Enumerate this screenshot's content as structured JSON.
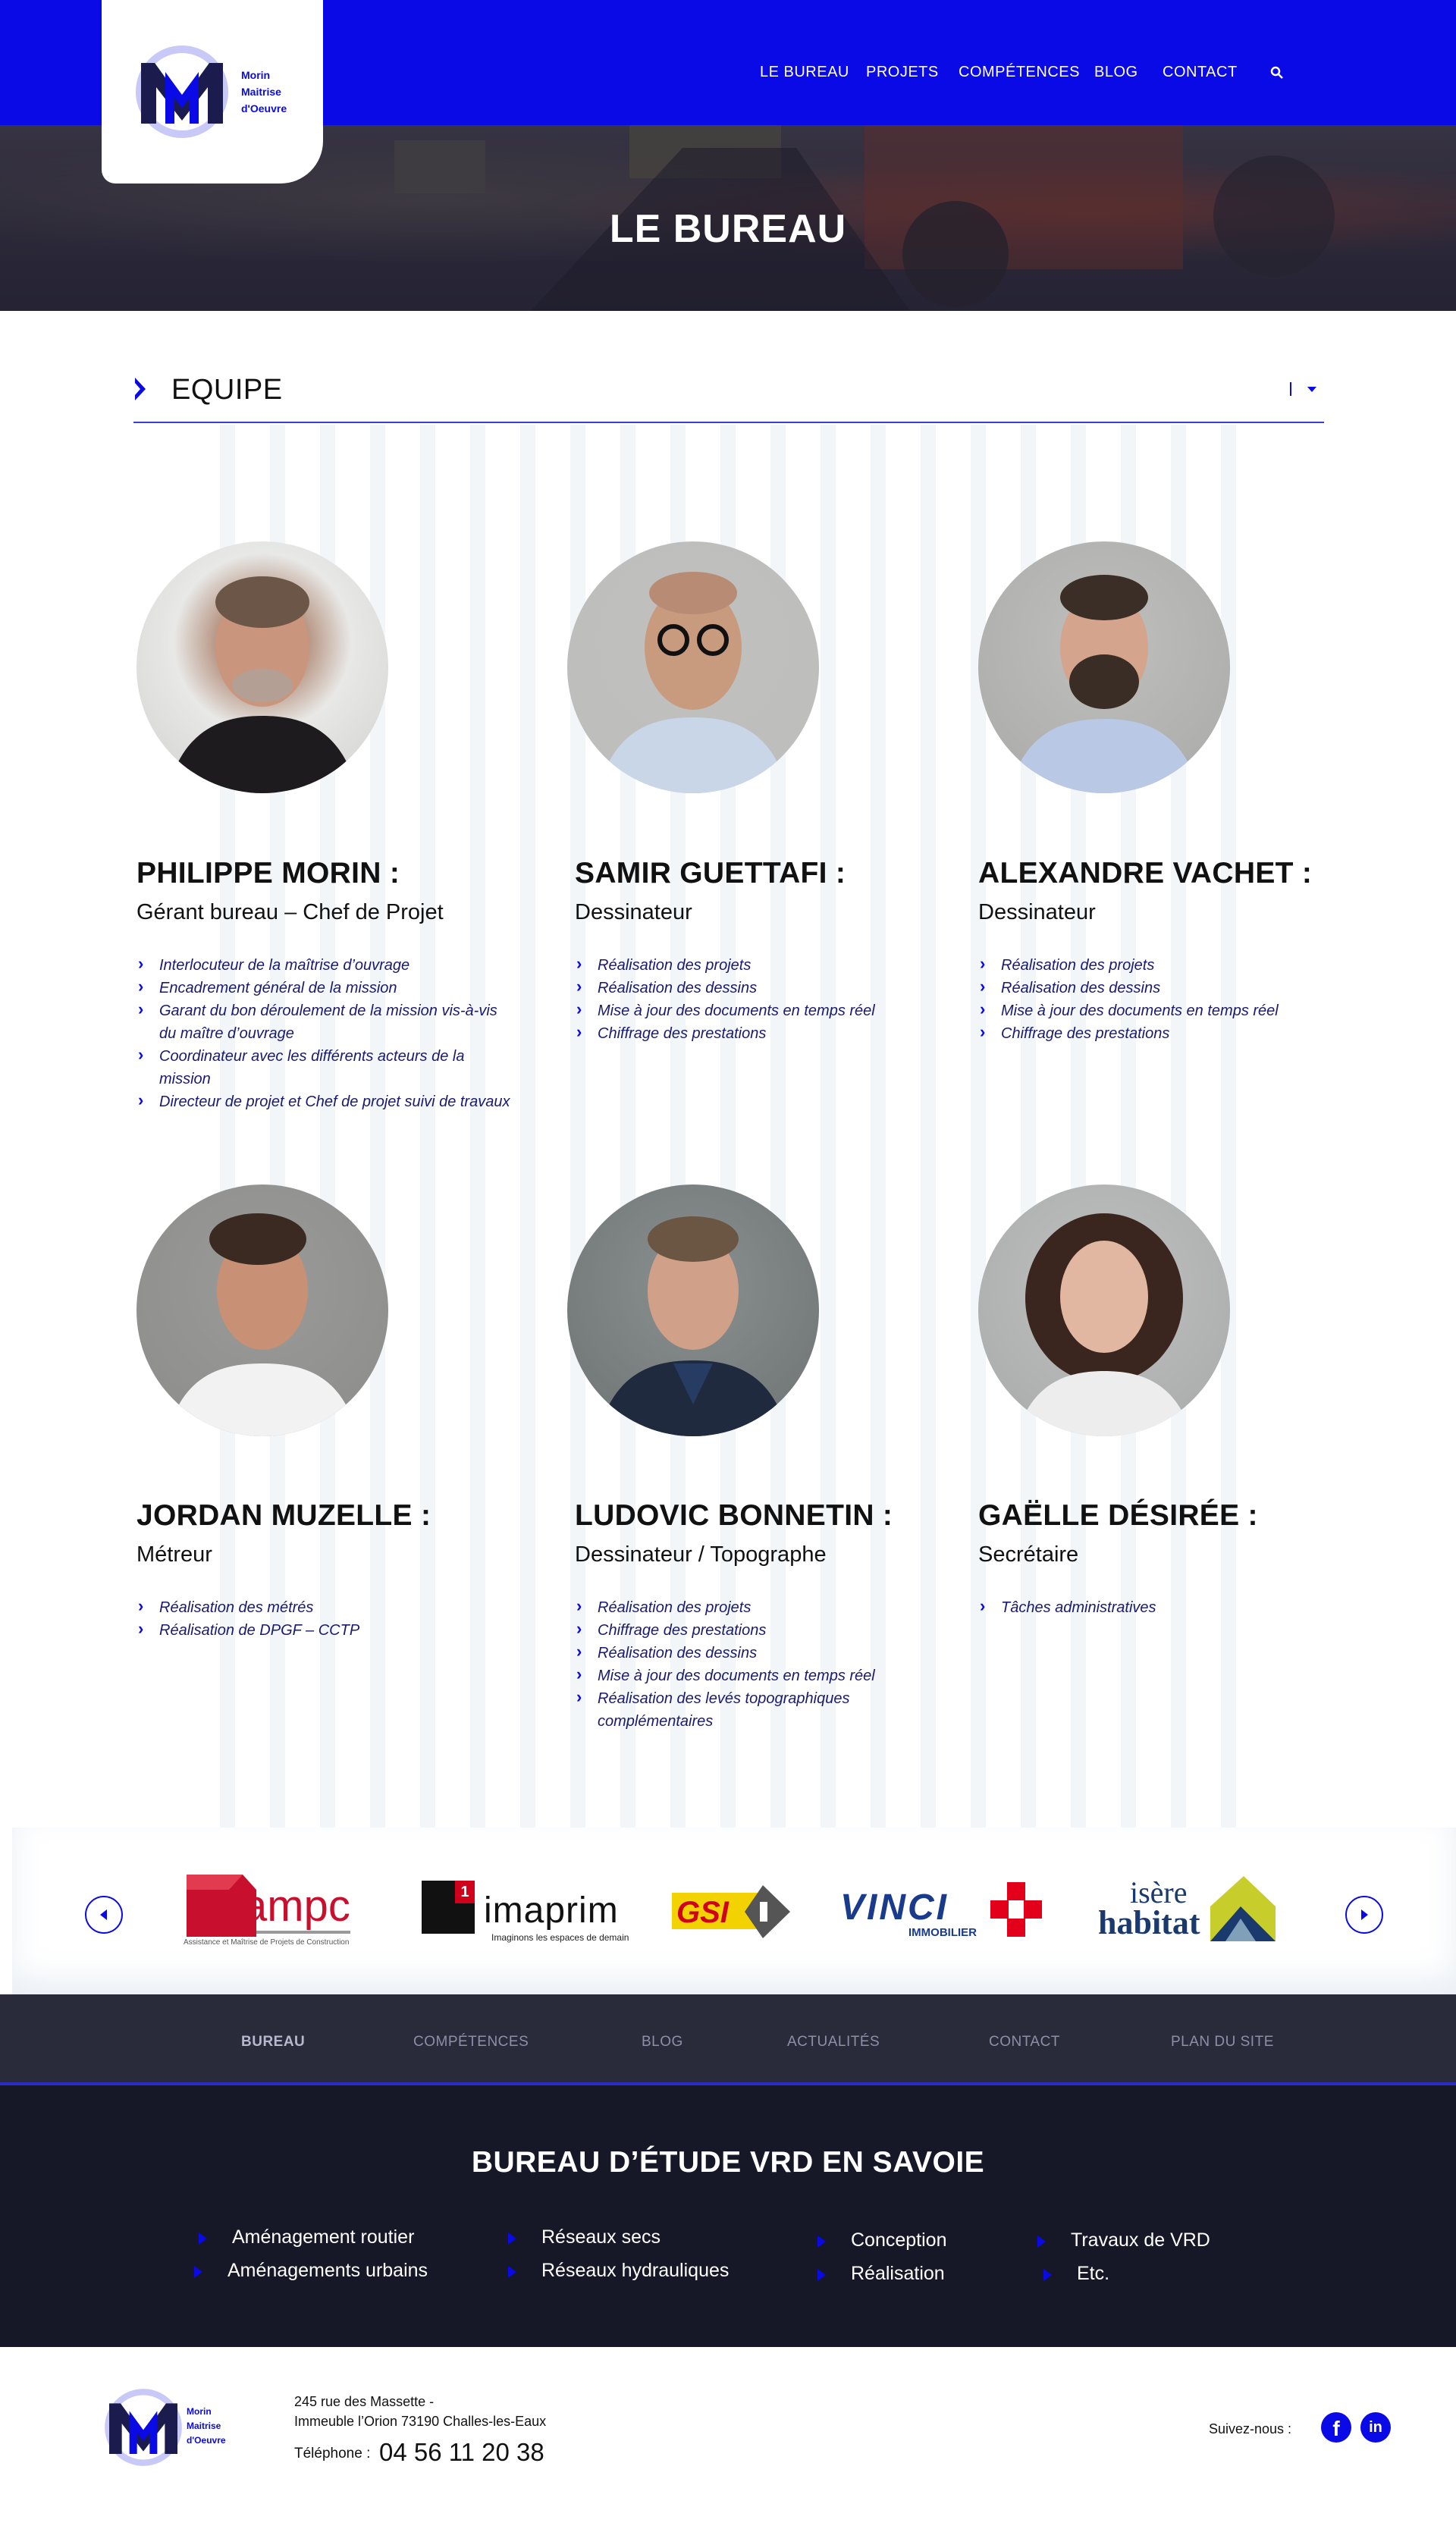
{
  "header": {
    "logo_lines": [
      "Morin",
      "Maitrise",
      "d'Oeuvre"
    ],
    "nav": [
      "Le Bureau",
      "Projets",
      "Compétences",
      "Blog",
      "Contact"
    ],
    "page_title": "LE BUREAU"
  },
  "section": {
    "title": "EQUIPE"
  },
  "team": [
    {
      "name": "PHILIPPE MORIN :",
      "role": "Gérant bureau – Chef de Projet",
      "tasks": [
        "Interlocuteur de la maîtrise d’ouvrage",
        "Encadrement général de la mission",
        "Garant du bon déroulement de la mission vis-à-vis du maître d’ouvrage",
        "Coordinateur avec les différents acteurs de la mission",
        "Directeur de projet et Chef de projet suivi de travaux"
      ]
    },
    {
      "name": "SAMIR GUETTAFI :",
      "role": "Dessinateur",
      "tasks": [
        "Réalisation des projets",
        "Réalisation des dessins",
        "Mise à jour des documents en temps réel",
        "Chiffrage des prestations"
      ]
    },
    {
      "name": "ALEXANDRE VACHET :",
      "role": "Dessinateur",
      "tasks": [
        "Réalisation des projets",
        "Réalisation des dessins",
        "Mise à jour des documents en temps réel",
        "Chiffrage des prestations"
      ]
    },
    {
      "name": "JORDAN MUZELLE  :",
      "role": "Métreur",
      "tasks": [
        "Réalisation des métrés",
        "Réalisation de DPGF – CCTP"
      ]
    },
    {
      "name": "LUDOVIC BONNETIN :",
      "role": "Dessinateur / Topographe",
      "tasks": [
        "Réalisation des projets",
        "Chiffrage des prestations",
        "Réalisation des dessins",
        "Mise à jour des documents en temps réel",
        "Réalisation des levés topographiques complémentaires"
      ]
    },
    {
      "name": "GAËLLE DÉSIRÉE :",
      "role": "Secrétaire",
      "tasks": [
        "Tâches administratives"
      ]
    }
  ],
  "partners": {
    "ampc": {
      "name": "ampc",
      "tagline": "Assistance et Maîtrise de Projets de Construction"
    },
    "imaprim": {
      "name": "imaprim",
      "tagline": "Imaginons les espaces de demain",
      "badge": "1"
    },
    "gsi": {
      "name": "GSI"
    },
    "vinci": {
      "name": "VINCI",
      "sub": "IMMOBILIER"
    },
    "isere": {
      "line1": "isère",
      "line2": "habitat"
    }
  },
  "footer_nav": [
    "Bureau",
    "Compétences",
    "Blog",
    "Actualités",
    "Contact",
    "Plan du site"
  ],
  "footer": {
    "title": "BUREAU D’ÉTUDE VRD EN SAVOIE",
    "services": [
      "Aménagement routier",
      "Aménagements urbains",
      "Réseaux secs",
      "Réseaux hydrauliques",
      "Conception",
      "Réalisation",
      "Travaux de VRD",
      "Etc."
    ],
    "address_line1": "245 rue des Massette -",
    "address_line2": "Immeuble l’Orion 73190 Challes-les-Eaux",
    "phone_label": "Téléphone :",
    "phone": "04 56 11 20 38",
    "follow_label": "Suivez-nous :",
    "social": [
      "f",
      "in"
    ]
  },
  "colors": {
    "brand_blue": "#0a0ae6",
    "footer_dark": "#171827",
    "footer_nav": "#2a2b3a"
  }
}
